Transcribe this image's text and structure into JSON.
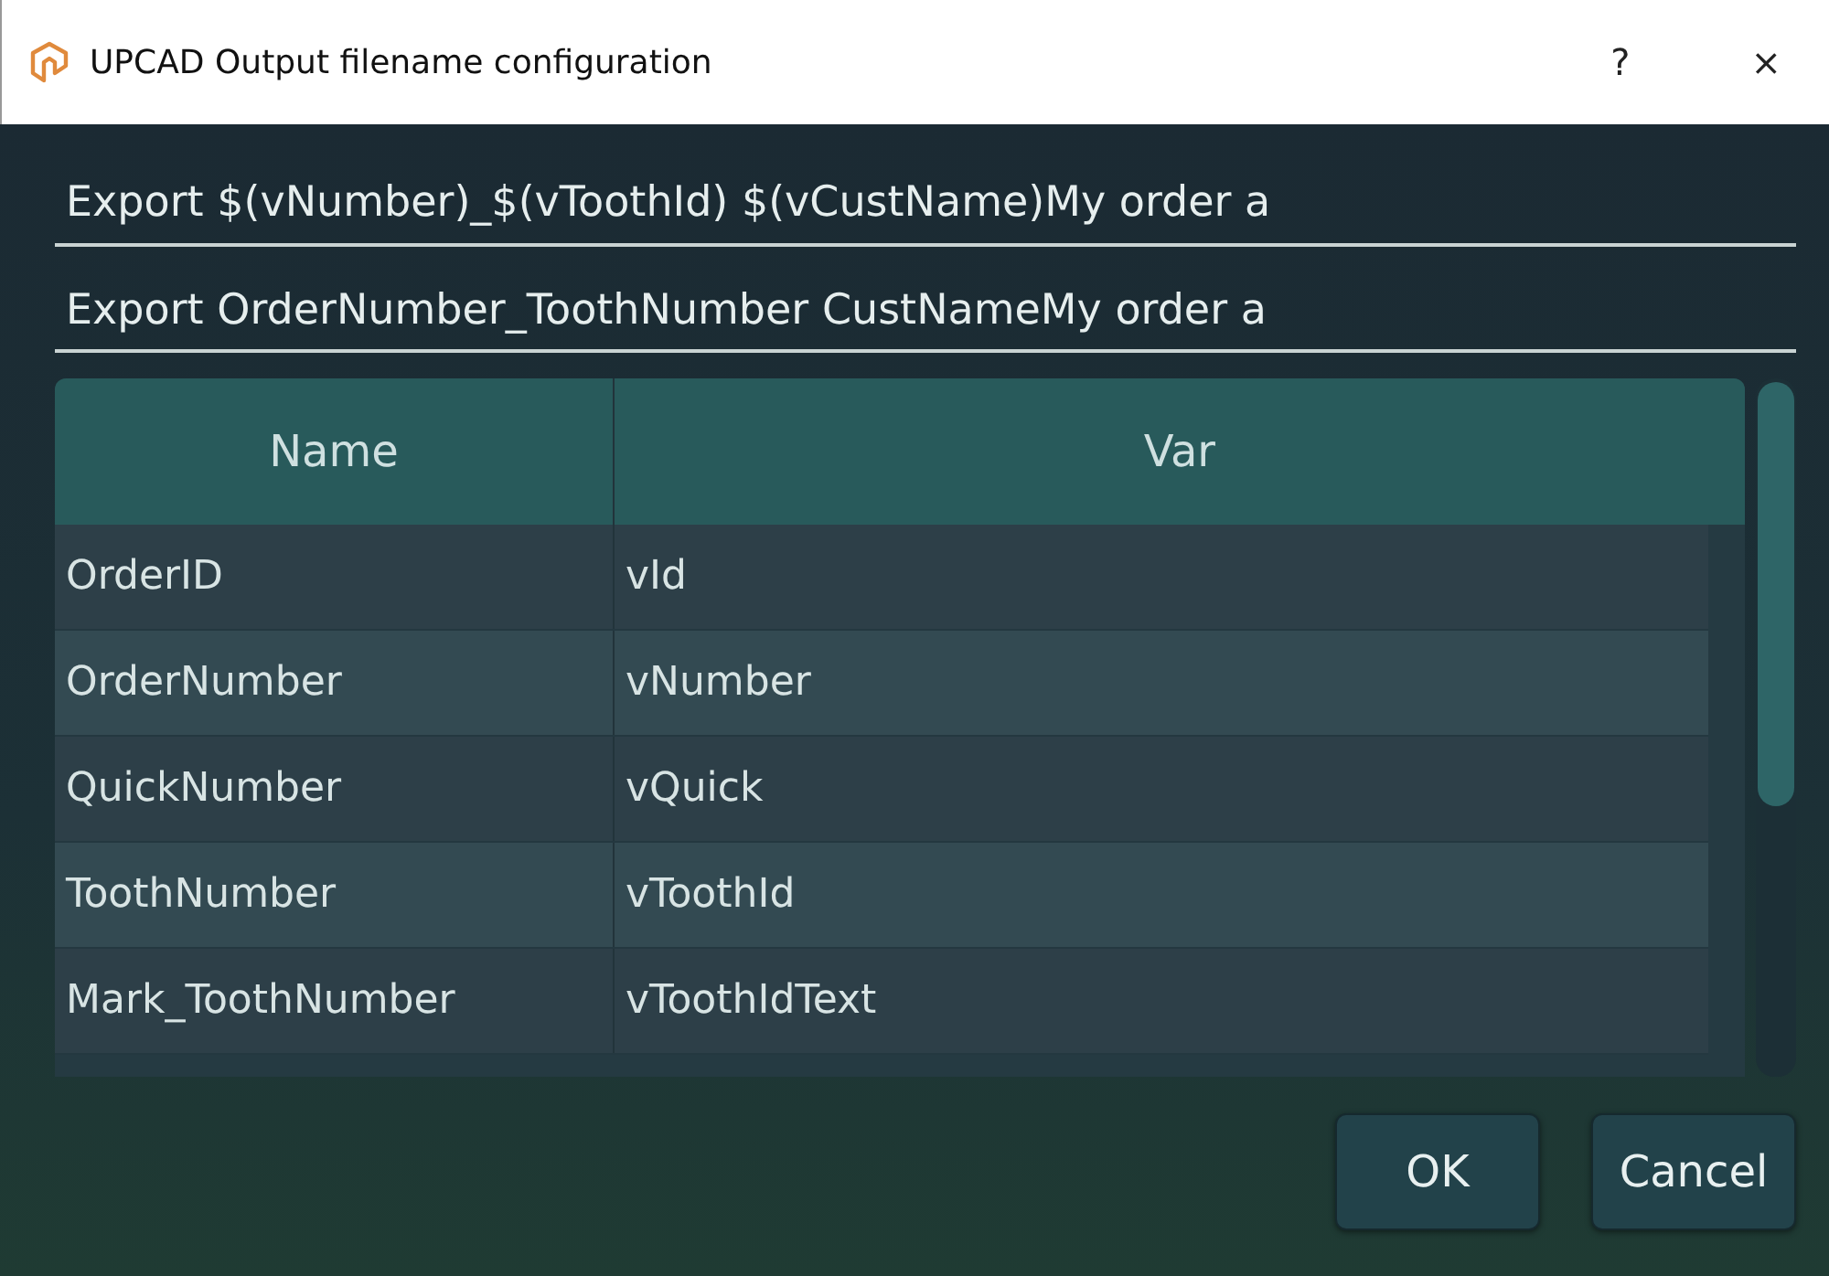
{
  "window": {
    "title": "UPCAD Output filename configuration",
    "help": "?",
    "close": "×"
  },
  "pattern_field": {
    "value": "Export $(vNumber)_$(vToothId) $(vCustName)My order a"
  },
  "preview_field": {
    "value": "Export OrderNumber_ToothNumber CustNameMy order a"
  },
  "table": {
    "columns": [
      "Name",
      "Var"
    ],
    "rows": [
      {
        "cells": [
          "OrderID",
          "vId"
        ]
      },
      {
        "cells": [
          "OrderNumber",
          "vNumber"
        ]
      },
      {
        "cells": [
          "QuickNumber",
          "vQuick"
        ]
      },
      {
        "cells": [
          "ToothNumber",
          "vToothId"
        ]
      },
      {
        "cells": [
          "Mark_ToothNumber",
          "vToothIdText"
        ]
      }
    ]
  },
  "buttons": [
    "OK",
    "Cancel"
  ]
}
